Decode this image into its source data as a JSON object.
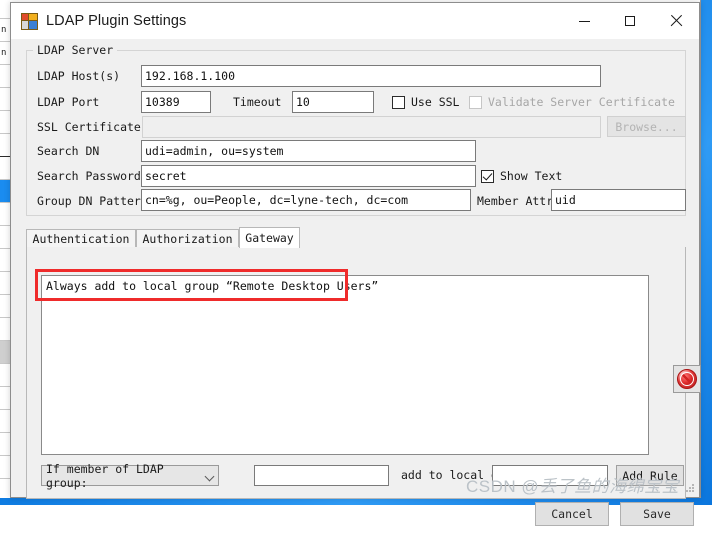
{
  "window": {
    "title": "LDAP Plugin Settings",
    "icon": "app-window-icon",
    "minimize": "—",
    "maximize": "□",
    "close": "✕"
  },
  "server_group": {
    "legend": "LDAP Server",
    "fields": [
      {
        "label": "LDAP Host(s)",
        "value": "192.168.1.100"
      },
      {
        "label": "LDAP Port",
        "value": "10389"
      },
      {
        "label": "Timeout",
        "value": "10"
      },
      {
        "label": "SSL Certificate F",
        "value": ""
      },
      {
        "label": "Search DN",
        "value": "udi=admin, ou=system"
      },
      {
        "label": "Search Password",
        "value": "secret"
      },
      {
        "label": "Group DN Pattern",
        "value": "cn=%g, ou=People, dc=lyne-tech, dc=com"
      },
      {
        "label": "Member Attribut",
        "value": "uid"
      }
    ],
    "use_ssl": {
      "label": "Use SSL",
      "checked": false
    },
    "validate_cert": {
      "label": "Validate Server Certificate",
      "checked": false,
      "disabled": true
    },
    "browse_button": {
      "label": "Browse...",
      "disabled": true
    },
    "show_text": {
      "label": "Show Text",
      "checked": true
    }
  },
  "tabs": [
    {
      "label": "Authentication",
      "active": false
    },
    {
      "label": "Authorization",
      "active": false
    },
    {
      "label": "Gateway",
      "active": true
    }
  ],
  "gateway": {
    "rules": [
      "Always add to local group “Remote Desktop Users”"
    ],
    "delete_button_icon": "no-entry-icon",
    "builder": {
      "condition_select": "If member of LDAP group:",
      "group_value": "",
      "middle_label": "add to local group:",
      "local_group_value": "",
      "add_rule_button": "Add Rule"
    }
  },
  "footer": {
    "cancel": "Cancel",
    "save": "Save"
  },
  "watermark": {
    "prefix": "CSDN @",
    "text": "丢了鱼的海绵宝宝"
  },
  "background": {
    "row_text": "n"
  },
  "colors": {
    "accent_red": "#ef2b2b",
    "desktop_blue": "#1f8fef",
    "dialog_bg": "#f0f0f0"
  }
}
